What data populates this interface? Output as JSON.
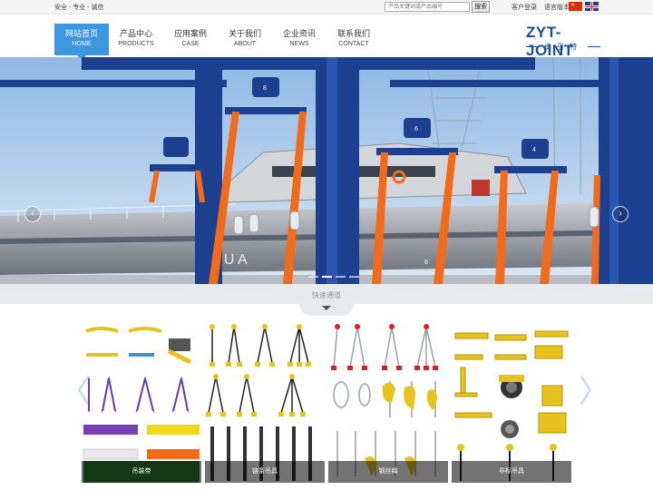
{
  "topbar": {
    "slogan": "安全 - 专业 - 诚信",
    "search_placeholder": "产品关键词或产品编号",
    "search_button": "搜索",
    "login": "客户登录",
    "language": "语言版本"
  },
  "nav": {
    "items": [
      {
        "cn": "网站首页",
        "en": "HOME"
      },
      {
        "cn": "产品中心",
        "en": "PRODUCTS"
      },
      {
        "cn": "应用案例",
        "en": "CASE"
      },
      {
        "cn": "关于我们",
        "en": "ABOUT"
      },
      {
        "cn": "企业资讯",
        "en": "NEWS"
      },
      {
        "cn": "联系我们",
        "en": "CONTACT"
      }
    ],
    "active_index": 0
  },
  "logo": {
    "brand": "ZYT-JOINT",
    "sub": "卓引特"
  },
  "banner": {
    "prev": "‹",
    "next": "›",
    "slide_count": 4,
    "active_slide": 1,
    "ship_lettering": "G U A",
    "hoist_numbers": [
      "8",
      "6",
      "6",
      "4"
    ]
  },
  "quick_access": {
    "title": "快速通道"
  },
  "carousel": {
    "prev": "〈",
    "next": "〉"
  },
  "categories": [
    {
      "label": "吊装带"
    },
    {
      "label": "链条吊具"
    },
    {
      "label": "钢丝绳"
    },
    {
      "label": "非标吊具"
    }
  ],
  "colors": {
    "accent": "#3d97dc",
    "brand": "#1b4f93",
    "crane_blue": "#1d3f8f",
    "strap_orange": "#f26a1b",
    "hook_red": "#d62222",
    "chain_yellow": "#e6c31e"
  }
}
